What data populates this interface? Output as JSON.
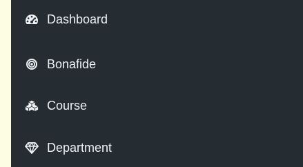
{
  "sidebar": {
    "items": [
      {
        "label": "Dashboard",
        "icon": "tachometer-icon"
      },
      {
        "label": "Bonafide",
        "icon": "bullseye-icon"
      },
      {
        "label": "Course",
        "icon": "cubes-icon"
      },
      {
        "label": "Department",
        "icon": "diamond-icon"
      }
    ]
  },
  "colors": {
    "page_background": "#fdfde3",
    "sidebar_background": "#252d32",
    "text": "#edf1f4"
  }
}
